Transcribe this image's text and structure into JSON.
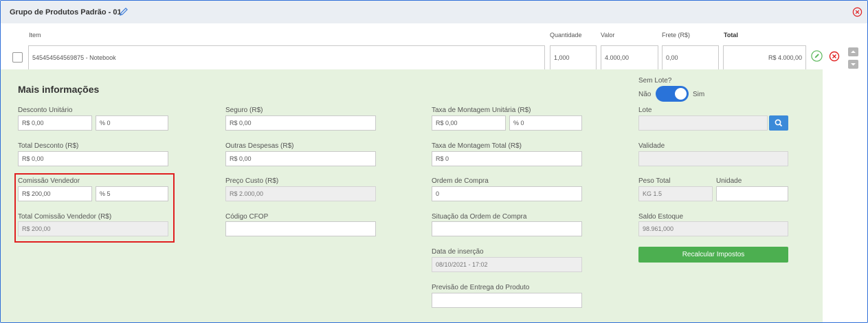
{
  "header": {
    "title": "Grupo de Produtos Padrão - 01"
  },
  "columns": {
    "item": "Item",
    "quantidade": "Quantidade",
    "valor": "Valor",
    "frete": "Frete (R$)",
    "total": "Total"
  },
  "row": {
    "item": "545454564569875 - Notebook",
    "quantidade": "1,000",
    "valor": "4.000,00",
    "frete": "0,00",
    "total": "R$ 4.000,00"
  },
  "more": {
    "title": "Mais informações",
    "sem_lote_label": "Sem Lote?",
    "toggle_off": "Não",
    "toggle_on": "Sim",
    "desconto_unitario_label": "Desconto Unitário",
    "desconto_unitario_valor": "R$ 0,00",
    "desconto_unitario_pct": "% 0",
    "total_desconto_label": "Total Desconto (R$)",
    "total_desconto_valor": "R$ 0,00",
    "comissao_label": "Comissão Vendedor",
    "comissao_valor": "R$ 200,00",
    "comissao_pct": "% 5",
    "total_comissao_label": "Total Comissão Vendedor (R$)",
    "total_comissao_valor": "R$ 200,00",
    "seguro_label": "Seguro (R$)",
    "seguro_valor": "R$ 0,00",
    "outras_label": "Outras Despesas (R$)",
    "outras_valor": "R$ 0,00",
    "preco_custo_label": "Preço Custo (R$)",
    "preco_custo_valor": "R$ 2.000,00",
    "cfop_label": "Código CFOP",
    "cfop_valor": "",
    "montagem_unit_label": "Taxa de Montagem Unitária (R$)",
    "montagem_unit_valor": "R$ 0,00",
    "montagem_unit_pct": "% 0",
    "montagem_total_label": "Taxa de Montagem Total (R$)",
    "montagem_total_valor": "R$ 0",
    "ordem_label": "Ordem de Compra",
    "ordem_valor": "0",
    "situacao_label": "Situação da Ordem de Compra",
    "situacao_valor": "",
    "data_insercao_label": "Data de inserção",
    "data_insercao_valor": "08/10/2021 - 17:02",
    "previsao_label": "Previsão de Entrega do Produto",
    "previsao_valor": "",
    "lote_label": "Lote",
    "lote_valor": "",
    "validade_label": "Validade",
    "validade_valor": "",
    "peso_label": "Peso Total",
    "peso_valor": "KG 1.5",
    "unidade_label": "Unidade",
    "unidade_valor": "",
    "saldo_label": "Saldo Estoque",
    "saldo_valor": "98.961,000",
    "recalcular_label": "Recalcular Impostos"
  },
  "colors": {
    "accent": "#2a73d9",
    "panel": "#e6f2df",
    "danger": "#e02020",
    "success": "#4caf50"
  },
  "icons": [
    "pencil-icon",
    "close-circle-icon",
    "edit-circle-icon",
    "delete-circle-icon",
    "search-icon",
    "arrow-up-icon",
    "arrow-down-icon"
  ]
}
